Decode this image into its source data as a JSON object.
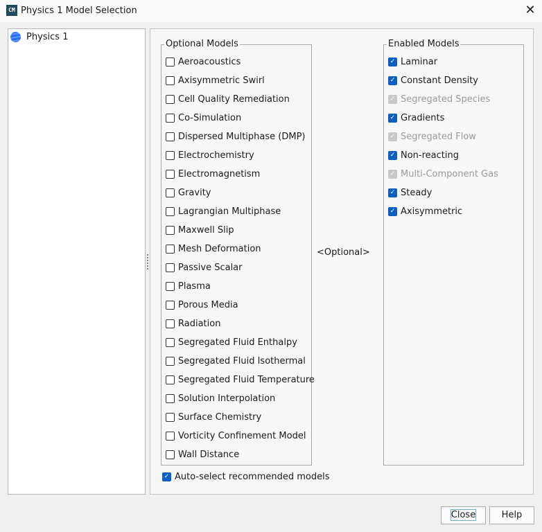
{
  "window": {
    "title": "Physics 1 Model Selection",
    "icon_text": "CM",
    "close_glyph": "✕"
  },
  "tree": {
    "items": [
      {
        "label": "Physics 1",
        "icon": "physics-continuum-icon"
      }
    ]
  },
  "optional_models": {
    "legend": "Optional Models",
    "items": [
      "Aeroacoustics",
      "Axisymmetric Swirl",
      "Cell Quality Remediation",
      "Co-Simulation",
      "Dispersed Multiphase (DMP)",
      "Electrochemistry",
      "Electromagnetism",
      "Gravity",
      "Lagrangian Multiphase",
      "Maxwell Slip",
      "Mesh Deformation",
      "Passive Scalar",
      "Plasma",
      "Porous Media",
      "Radiation",
      "Segregated Fluid Enthalpy",
      "Segregated Fluid Isothermal",
      "Segregated Fluid Temperature",
      "Solution Interpolation",
      "Surface Chemistry",
      "Vorticity Confinement Model",
      "Wall Distance"
    ]
  },
  "center_label": "<Optional>",
  "enabled_models": {
    "legend": "Enabled Models",
    "items": [
      {
        "label": "Laminar",
        "checked": true,
        "disabled": false
      },
      {
        "label": "Constant Density",
        "checked": true,
        "disabled": false
      },
      {
        "label": "Segregated Species",
        "checked": true,
        "disabled": true
      },
      {
        "label": "Gradients",
        "checked": true,
        "disabled": false
      },
      {
        "label": "Segregated Flow",
        "checked": true,
        "disabled": true
      },
      {
        "label": "Non-reacting",
        "checked": true,
        "disabled": false
      },
      {
        "label": "Multi-Component Gas",
        "checked": true,
        "disabled": true
      },
      {
        "label": "Steady",
        "checked": true,
        "disabled": false
      },
      {
        "label": "Axisymmetric",
        "checked": true,
        "disabled": false
      }
    ]
  },
  "auto_select": {
    "label": "Auto-select recommended models",
    "checked": true
  },
  "buttons": {
    "close": "Close",
    "help": "Help"
  },
  "colors": {
    "accent": "#0a5fbf"
  }
}
